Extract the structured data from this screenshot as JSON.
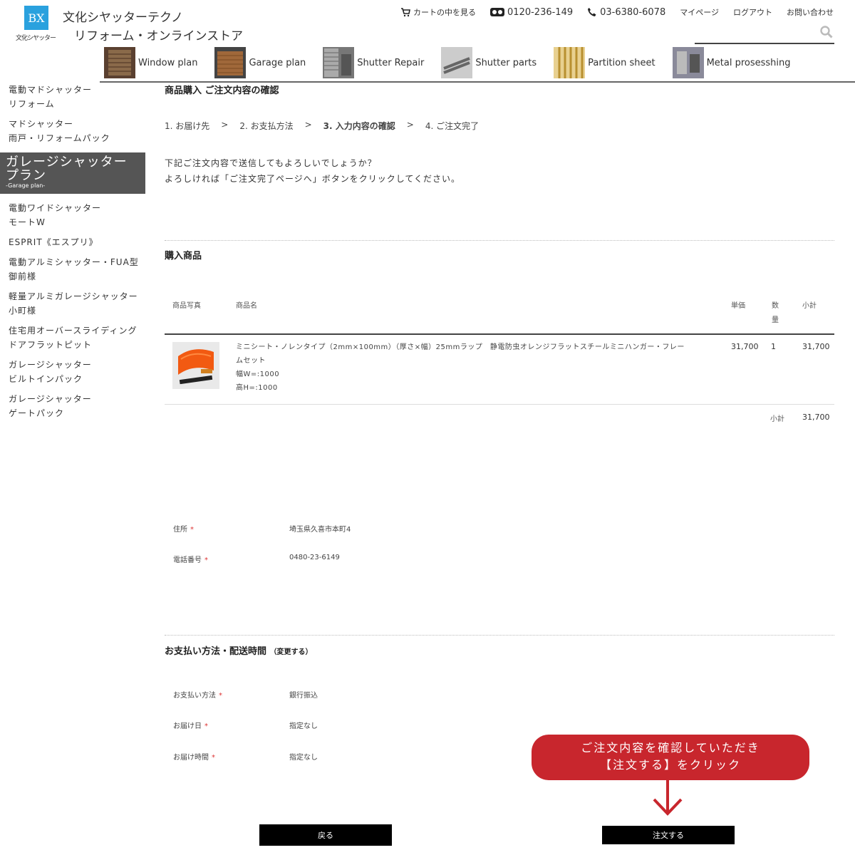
{
  "brand": {
    "logo_mark": "BX",
    "logo_small": "文化シヤッター",
    "line1": "文化シヤッターテクノ",
    "line2": "リフォーム・オンラインストア"
  },
  "topnav": {
    "cart": "カートの中を見る",
    "freedial": "0120-236-149",
    "phone": "03-6380-6078",
    "mypage": "マイページ",
    "logout": "ログアウト",
    "contact": "お問い合わせ"
  },
  "search": {
    "placeholder": ""
  },
  "categories": [
    {
      "label": "Window plan",
      "color": "#7a5a3a"
    },
    {
      "label": "Garage plan",
      "color": "#9a6a3a"
    },
    {
      "label": "Shutter Repair",
      "color": "#6a6a6a"
    },
    {
      "label": "Shutter parts",
      "color": "#8a8a8a"
    },
    {
      "label": "Partition sheet",
      "color": "#c8a040"
    },
    {
      "label": "Metal prosesshing",
      "color": "#6a6a7a"
    }
  ],
  "sidebar": {
    "top_items": [
      {
        "l1": "電動マドシャッター",
        "l2": "リフォーム"
      },
      {
        "l1": "マドシャッター",
        "l2": "雨戸・リフォームパック"
      }
    ],
    "head": {
      "l1": "ガレージシャッター",
      "l2": "プラン",
      "sub": "-Garage plan-"
    },
    "items": [
      {
        "l1": "電動ワイドシャッター",
        "l2": "モートW"
      },
      {
        "l1": "ESPRIT《エスプリ》",
        "l2": ""
      },
      {
        "l1": "電動アルミシャッター・FUA型",
        "l2": "御前様"
      },
      {
        "l1": "軽量アルミガレージシャッター",
        "l2": "小町様"
      },
      {
        "l1": "住宅用オーバースライディング",
        "l2": "ドアフラットピット"
      },
      {
        "l1": "ガレージシャッター",
        "l2": "ビルトインパック"
      },
      {
        "l1": "ガレージシャッター",
        "l2": "ゲートパック"
      }
    ]
  },
  "page": {
    "title": "商品購入 ご注文内容の確認",
    "steps": [
      "1. お届け先",
      ">",
      "2. お支払方法",
      ">",
      "3. 入力内容の確認",
      ">",
      "4. ご注文完了"
    ],
    "confirm_line1": "下記ご注文内容で送信してもよろしいでしょうか？",
    "confirm_line2": "よろしければ「ご注文完了ページへ」ボタンをクリックしてください。"
  },
  "products": {
    "section_title": "購入商品",
    "headers": {
      "photo": "商品写真",
      "name": "商品名",
      "price": "単価",
      "qty1": "数",
      "qty2": "量",
      "subtotal": "小計"
    },
    "row": {
      "name_line1": "ミニシート・ノレンタイプ（2mm×100mm）（厚さ×幅）25mmラップ　静電防虫オレンジフラットスチールミニハンガー・フレー",
      "name_line2": "ムセット",
      "width": "幅W=:1000",
      "height": "高H=:1000",
      "price": "31,700",
      "qty": "1",
      "subtotal": "31,700"
    },
    "subtotal_label": "小計",
    "subtotal_value": "31,700"
  },
  "address": {
    "address_label": "住所",
    "address_value": "埼玉県久喜市本町4",
    "phone_label": "電話番号",
    "phone_value": "0480-23-6149",
    "required_mark": "*"
  },
  "payment": {
    "section_title": "お支払い方法・配送時間",
    "change": "（変更する）",
    "method_label": "お支払い方法",
    "method_value": "銀行振込",
    "date_label": "お届け日",
    "date_value": "指定なし",
    "time_label": "お届け時間",
    "time_value": "指定なし"
  },
  "callout": {
    "line1": "ご注文内容を確認していただき",
    "line2": "【注文する】をクリック",
    "color": "#c8262d"
  },
  "buttons": {
    "back": "戻る",
    "order": "注文する"
  }
}
